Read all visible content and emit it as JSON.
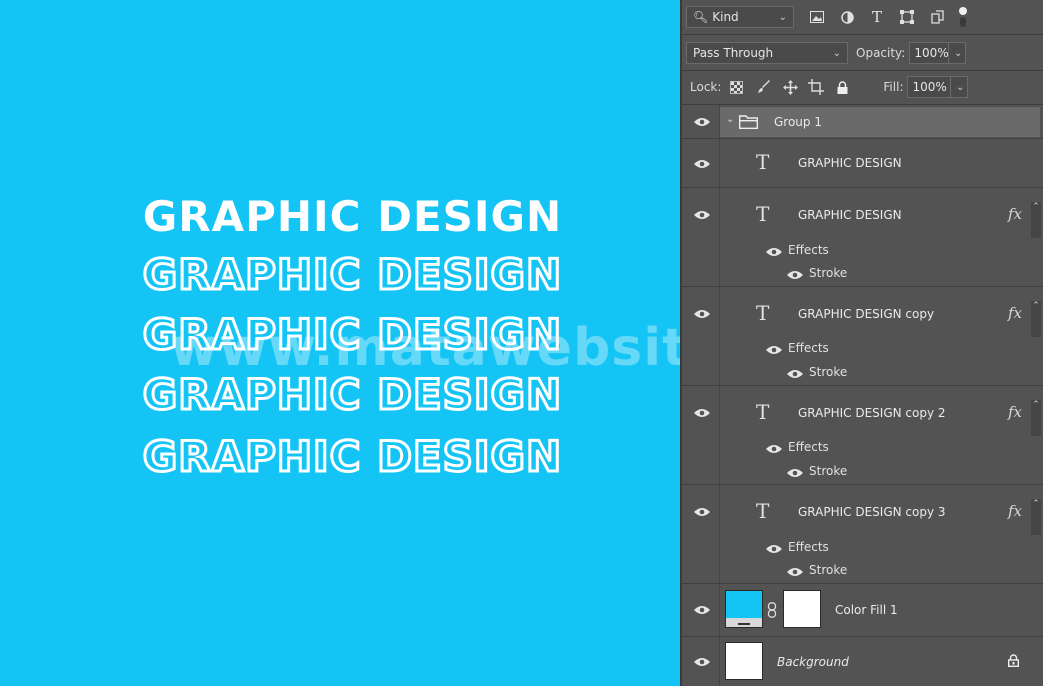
{
  "canvas": {
    "lines": [
      "GRAPHIC DESIGN",
      "GRAPHIC DESIGN",
      "GRAPHIC DESIGN",
      "GRAPHIC DESIGN",
      "GRAPHIC DESIGN"
    ],
    "watermark": "www.matawebsite.com",
    "background_color": "#14c4f5"
  },
  "toolbar": {
    "kind_label": "Kind",
    "blend_mode": "Pass Through",
    "opacity_label": "Opacity:",
    "opacity_value": "100%",
    "lock_label": "Lock:",
    "fill_label": "Fill:",
    "fill_value": "100%"
  },
  "layers": {
    "group": {
      "name": "Group 1"
    },
    "items": [
      {
        "name": "GRAPHIC DESIGN",
        "effects": false
      },
      {
        "name": "GRAPHIC DESIGN",
        "effects": true,
        "effects_label": "Effects",
        "stroke_label": "Stroke"
      },
      {
        "name": "GRAPHIC DESIGN copy",
        "effects": true,
        "effects_label": "Effects",
        "stroke_label": "Stroke"
      },
      {
        "name": "GRAPHIC DESIGN copy 2",
        "effects": true,
        "effects_label": "Effects",
        "stroke_label": "Stroke"
      },
      {
        "name": "GRAPHIC DESIGN copy 3",
        "effects": true,
        "effects_label": "Effects",
        "stroke_label": "Stroke"
      }
    ],
    "color_fill": {
      "name": "Color Fill 1",
      "color": "#14c4f5"
    },
    "background": {
      "name": "Background"
    },
    "fx_label": "fx"
  }
}
